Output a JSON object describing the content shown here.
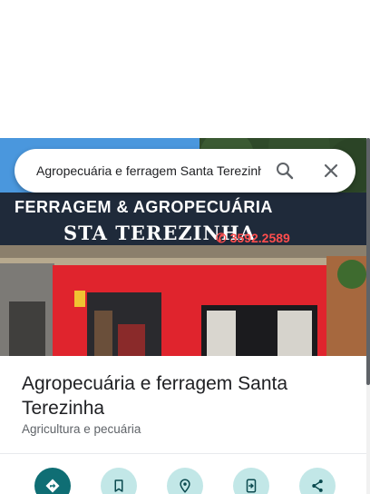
{
  "search": {
    "query": "Agropecuária e ferragem Santa Terezinha",
    "search_icon": "search-icon",
    "close_icon": "close-icon"
  },
  "photo": {
    "sign_line1": "FERRAGEM & AGROPECUÁRIA",
    "sign_line2": "STA TEREZINHA",
    "sign_phone": "✆ 3592.2589"
  },
  "place": {
    "title": "Agropecuária e ferragem Santa Terezinha",
    "category": "Agricultura e pecuária"
  },
  "actions": [
    {
      "icon": "directions-icon"
    },
    {
      "icon": "save-bookmark-icon"
    },
    {
      "icon": "nearby-icon"
    },
    {
      "icon": "send-to-phone-icon"
    },
    {
      "icon": "share-icon"
    }
  ],
  "colors": {
    "accent": "#0f6e74",
    "action_bg": "#c2e7e7",
    "store_red": "#e0242d"
  }
}
